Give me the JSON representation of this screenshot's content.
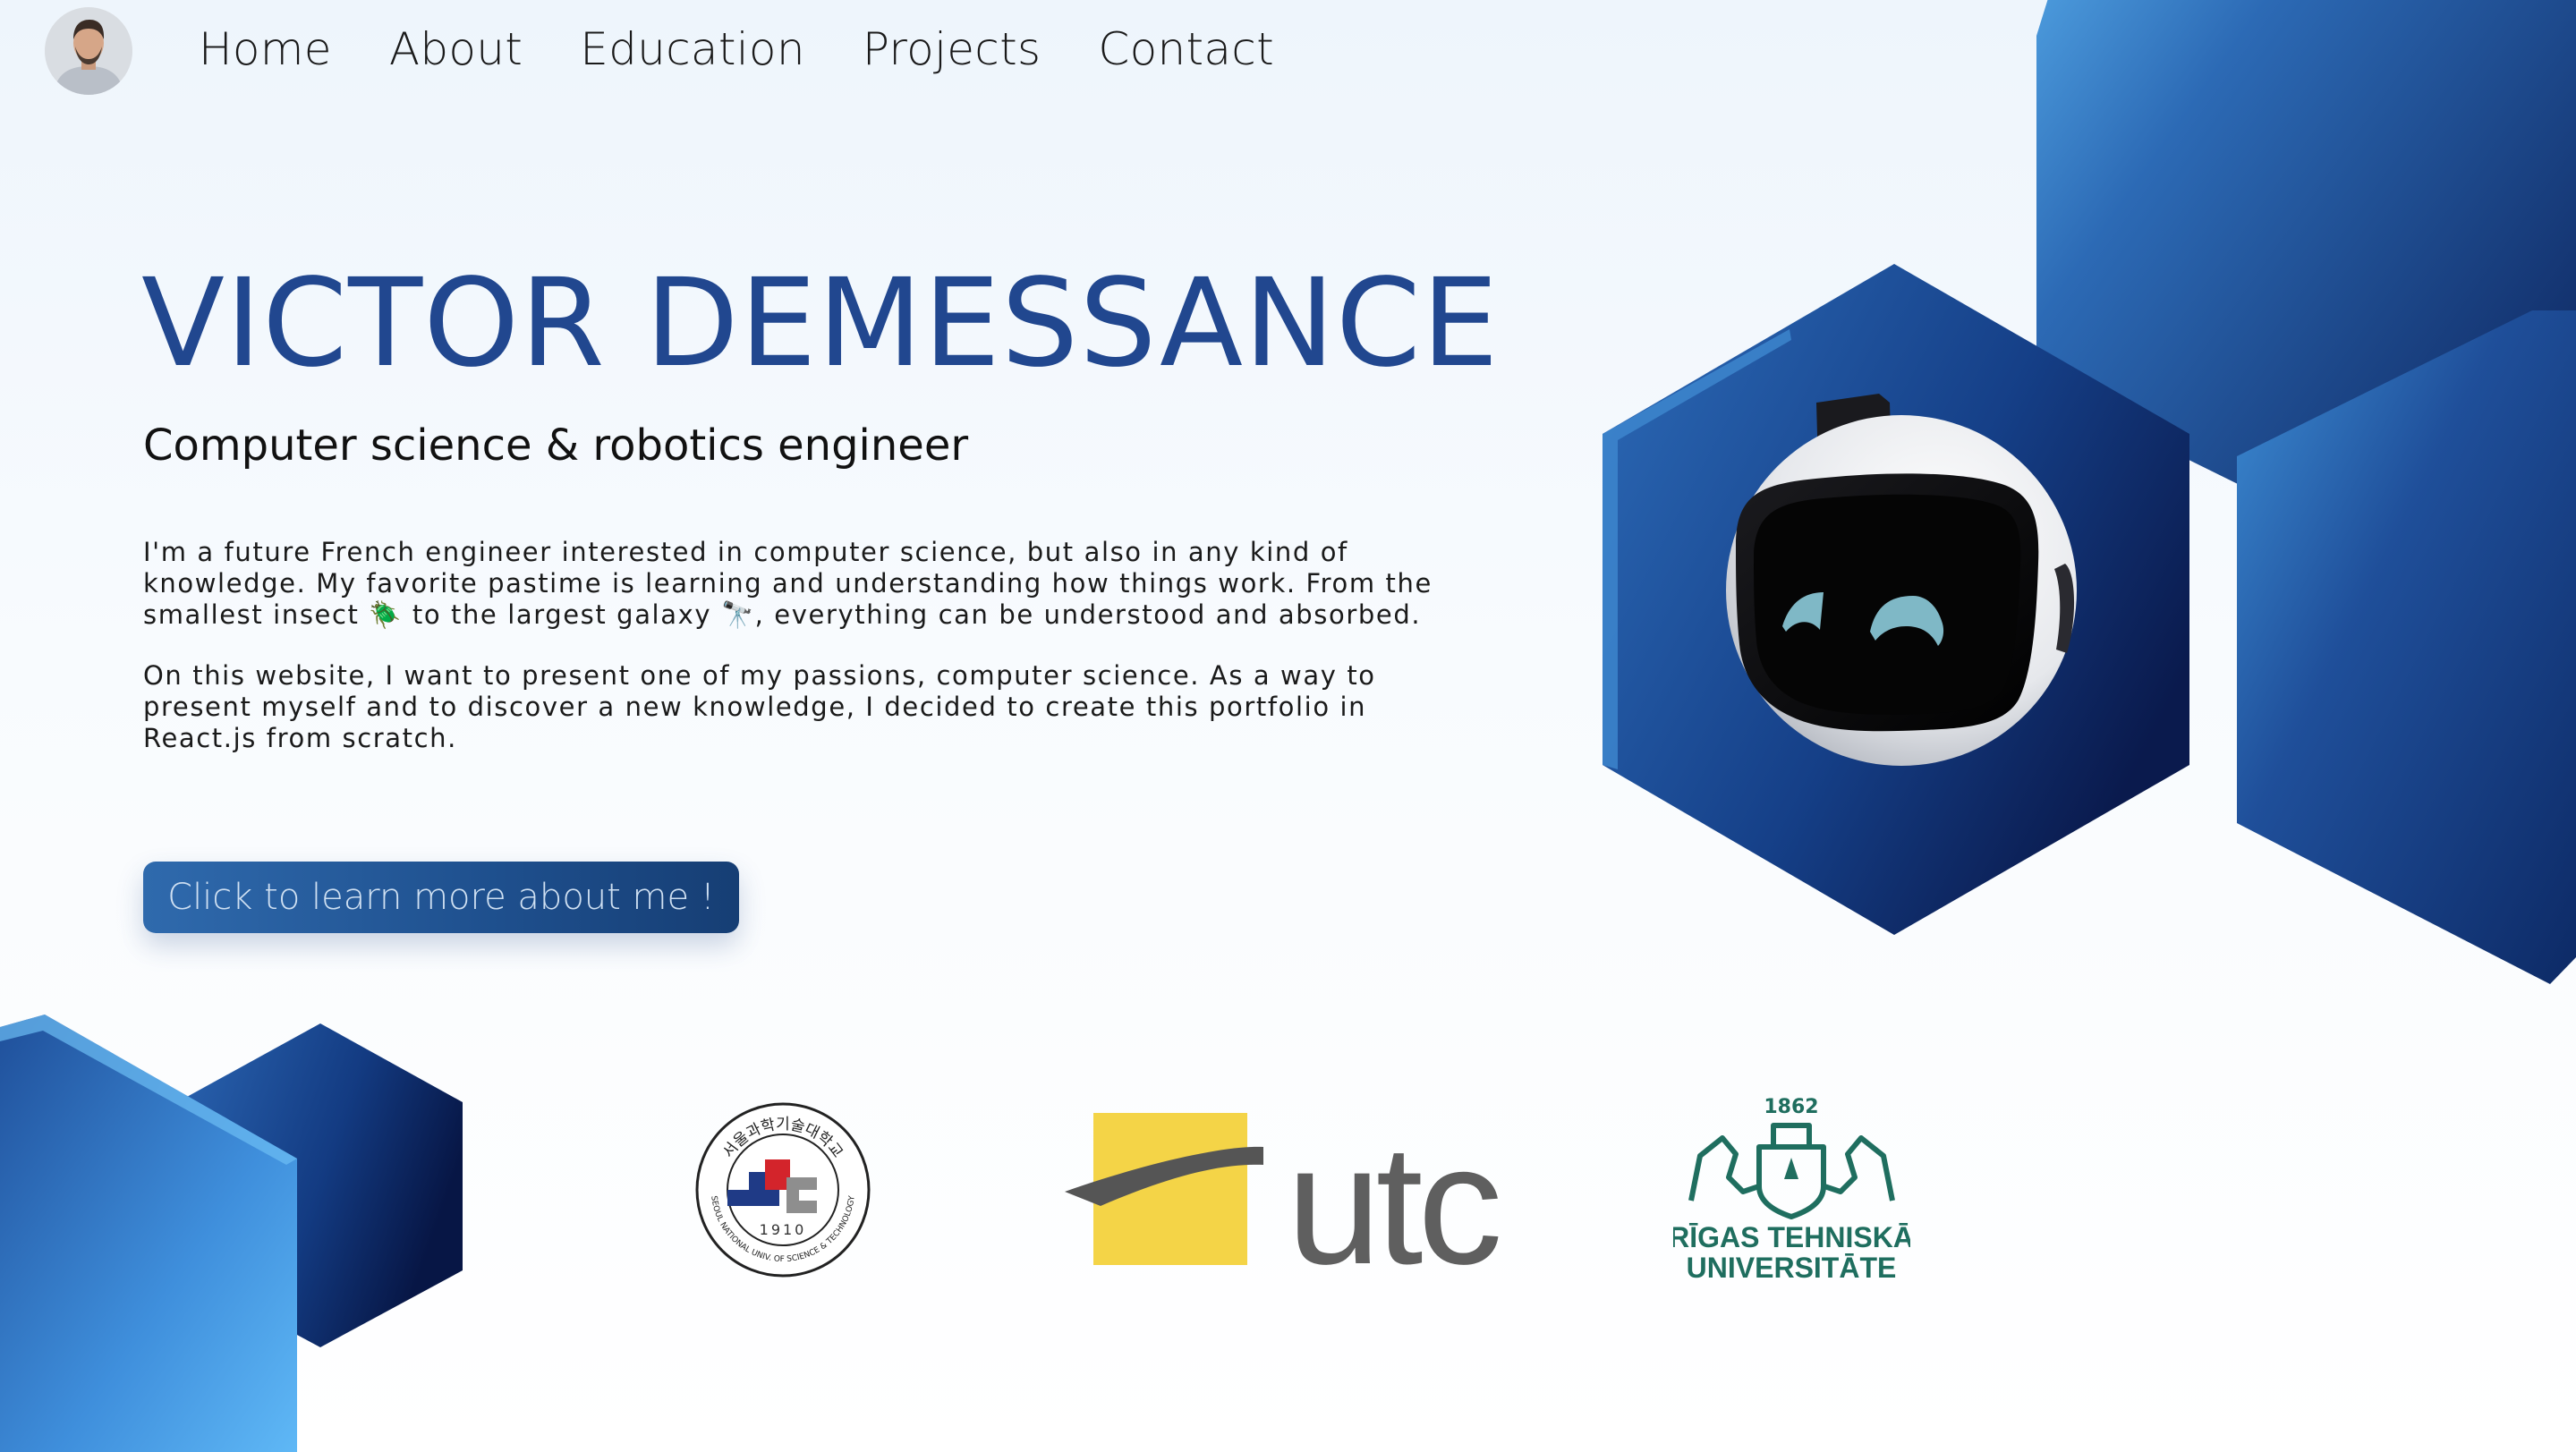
{
  "nav": {
    "avatar_alt": "avatar",
    "links": [
      "Home",
      "About",
      "Education",
      "Projects",
      "Contact"
    ]
  },
  "hero": {
    "title": "VICTOR DEMESSANCE",
    "subtitle": "Computer science & robotics engineer",
    "bio_p1_a": "I'm a future French engineer interested in computer science, but also in any kind of knowledge. My favorite pastime is learning and understanding how things work. From the smallest insect ",
    "bio_p1_b": " to the largest galaxy ",
    "bio_p1_c": ", everything can be understood and absorbed.",
    "bio_p2": "On this website, I want to present one of my passions, computer science. As a way to present myself and to discover a new knowledge, I decided to create this portfolio in React.js from scratch.",
    "cta_label": "Click to learn more about me !"
  },
  "emoji": {
    "insect": "🪲",
    "telescope": "🔭"
  },
  "logos": {
    "seoultech": {
      "korean": "서울과학기술대학교",
      "english": "SEOUL NATIONAL UNIV. OF SCIENCE & TECHNOLOGY",
      "year": "1910"
    },
    "utc": {
      "text": "utc"
    },
    "rtu": {
      "year": "1862",
      "line1": "RĪGAS TEHNISKĀ",
      "line2": "UNIVERSITĀTE"
    }
  },
  "colors": {
    "accent": "#21478f",
    "hex_dark": "#0a1f55",
    "hex_light": "#5ab4f3",
    "utc_yellow": "#f4d447",
    "utc_gray": "#5f5f5f",
    "rtu_green": "#1f6e5f"
  }
}
